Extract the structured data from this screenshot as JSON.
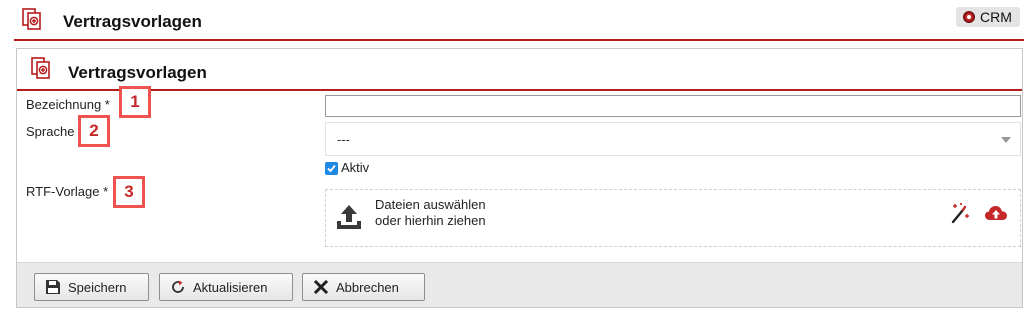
{
  "header": {
    "title": "Vertragsvorlagen",
    "icon": "document-add-icon",
    "badge": "CRM",
    "accent_color": "#b71c1c"
  },
  "panel": {
    "title": "Vertragsvorlagen",
    "icon": "document-add-icon"
  },
  "form": {
    "bezeichnung": {
      "label": "Bezeichnung *",
      "value": "",
      "marker": "1"
    },
    "sprache": {
      "label": "Sprache",
      "value": "---",
      "marker": "2"
    },
    "aktiv": {
      "label": "Aktiv",
      "checked": true
    },
    "rtf_vorlage": {
      "label": "RTF-Vorlage *",
      "marker": "3",
      "dropzone_line1": "Dateien auswählen",
      "dropzone_line2": "oder hierhin ziehen",
      "icons": [
        "upload-icon",
        "magic-wand-icon",
        "cloud-upload-icon"
      ]
    }
  },
  "footer": {
    "save_label": "Speichern",
    "refresh_label": "Aktualisieren",
    "cancel_label": "Abbrechen"
  }
}
